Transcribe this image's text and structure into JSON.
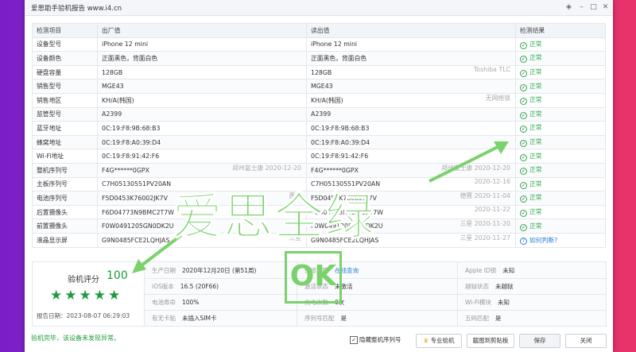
{
  "window": {
    "title": "爱思助手验机报告 www.i4.cn"
  },
  "table": {
    "headers": [
      "检测项目",
      "出厂值",
      "读出值",
      "检测结果"
    ],
    "rows": [
      {
        "item": "设备型号",
        "factory": "iPhone 12 mini",
        "factory_note": "",
        "read": "iPhone 12 mini",
        "read_note": "",
        "result": "正常"
      },
      {
        "item": "设备颜色",
        "factory": "正面黑色，背面白色",
        "factory_note": "",
        "read": "正面黑色，背面白色",
        "read_note": "",
        "result": "正常"
      },
      {
        "item": "硬盘容量",
        "factory": "128GB",
        "factory_note": "",
        "read": "128GB",
        "read_note": "Toshiba TLC",
        "result": "正常"
      },
      {
        "item": "销售型号",
        "factory": "MGE43",
        "factory_note": "",
        "read": "MGE43",
        "read_note": "",
        "result": "正常"
      },
      {
        "item": "销售地区",
        "factory": "KH/A(韩国)",
        "factory_note": "",
        "read": "KH/A(韩国)",
        "read_note": "无网络锁",
        "result": "正常"
      },
      {
        "item": "监管型号",
        "factory": "A2399",
        "factory_note": "",
        "read": "A2399",
        "read_note": "",
        "result": "正常"
      },
      {
        "item": "蓝牙地址",
        "factory": "0C:19:F8:9B:68:B3",
        "factory_note": "",
        "read": "0C:19:F8:9B:68:B3",
        "read_note": "",
        "result": "正常"
      },
      {
        "item": "蜂窝地址",
        "factory": "0C:19:F8:A0:39:D4",
        "factory_note": "",
        "read": "0C:19:F8:A0:39:D4",
        "read_note": "",
        "result": "正常"
      },
      {
        "item": "Wi-Fi地址",
        "factory": "0C:19:F8:91:42:F6",
        "factory_note": "",
        "read": "0C:19:F8:91:42:F6",
        "read_note": "",
        "result": "正常"
      },
      {
        "item": "整机序列号",
        "factory": "F4G******0GPX",
        "factory_note": "郑州富士康 2020-12-20",
        "read": "F4G******0GPX",
        "read_note": "郑州富士康 2020-12-20",
        "result": "正常"
      },
      {
        "item": "主板序列号",
        "factory": "C7H05130551PV20AN",
        "factory_note": "",
        "read": "C7H05130551PV20AN",
        "read_note": "2020-12-16",
        "result": "正常"
      },
      {
        "item": "电池序列号",
        "factory": "F5D0453K76002JK7V",
        "factory_note": "惠州",
        "read": "F5D0453K76002JK7V",
        "read_note": "德赛 2020-11-04",
        "result": "正常"
      },
      {
        "item": "后置摄像头",
        "factory": "F6D04773N9BMC2T7W",
        "factory_note": "",
        "read": "F6D04773N9BMC2T7W",
        "read_note": "2020-11-22",
        "result": "正常"
      },
      {
        "item": "前置摄像头",
        "factory": "F0W0491205GN0DK2U",
        "factory_note": "",
        "read": "F0W0491205GN0DK2U",
        "read_note": "三星 2020-11-20",
        "result": "正常"
      },
      {
        "item": "液晶显示屏",
        "factory": "G9N0485FCE2LQHJAS",
        "factory_note": "三星",
        "read": "G9N0485FCE2LQHJAS",
        "read_note": "三星 2020-11-27",
        "result": "如何判断?"
      }
    ]
  },
  "summary": {
    "score_label": "验机评分",
    "score": "100",
    "stars": "★★★★★",
    "report_time": "报告日期：2023-08-07 06:29:03",
    "fields": {
      "produce_date_k": "生产日期",
      "produce_date_v": "2020年12月20日 (第51周)",
      "warranty_k": "保修期限",
      "warranty_v": "在线查询",
      "appleid_k": "Apple ID锁",
      "appleid_v": "未知",
      "ios_k": "iOS版本",
      "ios_v": "16.5 (20F66)",
      "activation_k": "激活状态",
      "activation_v": "未激活",
      "jailbreak_k": "越狱状态",
      "jailbreak_v": "未越狱",
      "battery_k": "电池寿命",
      "battery_v": "100%",
      "charge_k": "充电次数",
      "charge_v": "0次",
      "wifi_k": "Wi-Fi模块",
      "wifi_v": "未知",
      "sim_k": "有无卡贴",
      "sim_v": "未插入SIM卡",
      "serial_k": "序列号匹配",
      "serial_v": "是",
      "wuma_k": "五码匹配",
      "wuma_v": "是"
    }
  },
  "footer": {
    "status": "验机完毕，该设备未发现异常。",
    "hide_serial": "隐藏整机序列号",
    "pro_check": "专业验机",
    "screenshot": "截图到剪贴板",
    "save": "保存",
    "close": "关闭"
  },
  "overlay": {
    "headline": "爱思全绿",
    "ok": "OK"
  },
  "colors": {
    "ok_green": "#2aa84a",
    "overlay_green": "#7ad26b",
    "link_blue": "#2a7fd8"
  }
}
